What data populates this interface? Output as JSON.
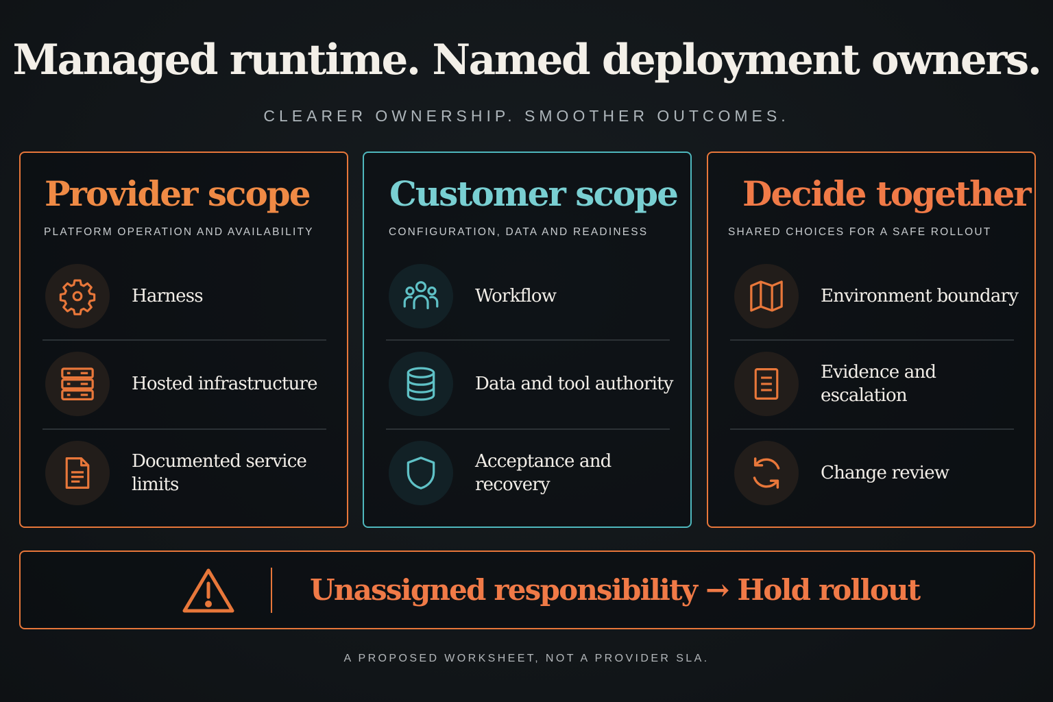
{
  "header": {
    "title": "Managed runtime. Named deployment owners.",
    "subtitle": "CLEARER OWNERSHIP. SMOOTHER OUTCOMES."
  },
  "colors": {
    "background": "#121619",
    "orange": "#e8773a",
    "teal": "#4fb8be",
    "text": "#f2eee8"
  },
  "panels": [
    {
      "title": "Provider scope",
      "subtitle": "PLATFORM OPERATION AND AVAILABILITY",
      "accent": "orange",
      "items": [
        {
          "label": "Harness",
          "icon": "gear-icon"
        },
        {
          "label": "Hosted infrastructure",
          "icon": "server-icon"
        },
        {
          "label": "Documented service limits",
          "icon": "document-icon"
        }
      ]
    },
    {
      "title": "Customer scope",
      "subtitle": "CONFIGURATION, DATA AND READINESS",
      "accent": "teal",
      "items": [
        {
          "label": "Workflow",
          "icon": "people-icon"
        },
        {
          "label": "Data and tool authority",
          "icon": "database-icon"
        },
        {
          "label": "Acceptance and recovery",
          "icon": "shield-icon"
        }
      ]
    },
    {
      "title": "Decide together",
      "subtitle": "SHARED CHOICES FOR A SAFE ROLLOUT",
      "accent": "orange",
      "items": [
        {
          "label": "Environment boundary",
          "icon": "map-icon"
        },
        {
          "label": "Evidence and escalation",
          "icon": "list-document-icon"
        },
        {
          "label": "Change review",
          "icon": "refresh-icon"
        }
      ]
    }
  ],
  "banner": {
    "text": "Unassigned responsibility → Hold rollout",
    "icon": "warning-icon"
  },
  "footnote": "A PROPOSED WORKSHEET, NOT A PROVIDER SLA."
}
